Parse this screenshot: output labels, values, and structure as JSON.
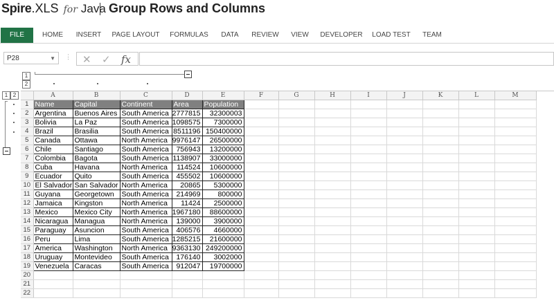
{
  "header": {
    "brand_spire": "Spire",
    "brand_xls": ".XLS",
    "brand_for": "for",
    "brand_java": "Java",
    "page_title": "Group Rows and Columns"
  },
  "ribbon": {
    "tabs": [
      "FILE",
      "HOME",
      "INSERT",
      "PAGE LAYOUT",
      "FORMULAS",
      "DATA",
      "REVIEW",
      "VIEW",
      "DEVELOPER",
      "LOAD TEST",
      "TEAM"
    ],
    "active_tab": "FILE",
    "accent_color": "#217346"
  },
  "formula_bar": {
    "name_box": "P28",
    "cancel_icon": "cross-icon",
    "enter_icon": "check-icon",
    "function_label": "fx",
    "formula": ""
  },
  "outline": {
    "column_levels": [
      "1",
      "2"
    ],
    "row_levels": [
      "1",
      "2"
    ]
  },
  "sheet": {
    "columns": [
      "A",
      "B",
      "C",
      "D",
      "E",
      "F",
      "G",
      "H",
      "I",
      "J",
      "K",
      "L",
      "M"
    ],
    "row_numbers": [
      "1",
      "2",
      "3",
      "4",
      "5",
      "6",
      "7",
      "8",
      "9",
      "10",
      "11",
      "12",
      "13",
      "14",
      "15",
      "16",
      "17",
      "18",
      "19",
      "20",
      "21",
      "22"
    ],
    "table_header": [
      "Name",
      "Capital",
      "Continent",
      "Area",
      "Population"
    ],
    "rows": [
      [
        "Argentina",
        "Buenos Aires",
        "South America",
        "2777815",
        "32300003"
      ],
      [
        "Bolivia",
        "La Paz",
        "South America",
        "1098575",
        "7300000"
      ],
      [
        "Brazil",
        "Brasilia",
        "South America",
        "8511196",
        "150400000"
      ],
      [
        "Canada",
        "Ottawa",
        "North America",
        "9976147",
        "26500000"
      ],
      [
        "Chile",
        "Santiago",
        "South America",
        "756943",
        "13200000"
      ],
      [
        "Colombia",
        "Bagota",
        "South America",
        "1138907",
        "33000000"
      ],
      [
        "Cuba",
        "Havana",
        "North America",
        "114524",
        "10600000"
      ],
      [
        "Ecuador",
        "Quito",
        "South America",
        "455502",
        "10600000"
      ],
      [
        "El Salvador",
        "San Salvador",
        "North America",
        "20865",
        "5300000"
      ],
      [
        "Guyana",
        "Georgetown",
        "South America",
        "214969",
        "800000"
      ],
      [
        "Jamaica",
        "Kingston",
        "North America",
        "11424",
        "2500000"
      ],
      [
        "Mexico",
        "Mexico City",
        "North America",
        "1967180",
        "88600000"
      ],
      [
        "Nicaragua",
        "Managua",
        "North America",
        "139000",
        "3900000"
      ],
      [
        "Paraguay",
        "Asuncion",
        "South America",
        "406576",
        "4660000"
      ],
      [
        "Peru",
        "Lima",
        "South America",
        "1285215",
        "21600000"
      ],
      [
        "America",
        "Washington",
        "North America",
        "9363130",
        "249200000"
      ],
      [
        "Uruguay",
        "Montevideo",
        "South America",
        "176140",
        "3002000"
      ],
      [
        "Venezuela",
        "Caracas",
        "South America",
        "912047",
        "19700000"
      ]
    ]
  }
}
